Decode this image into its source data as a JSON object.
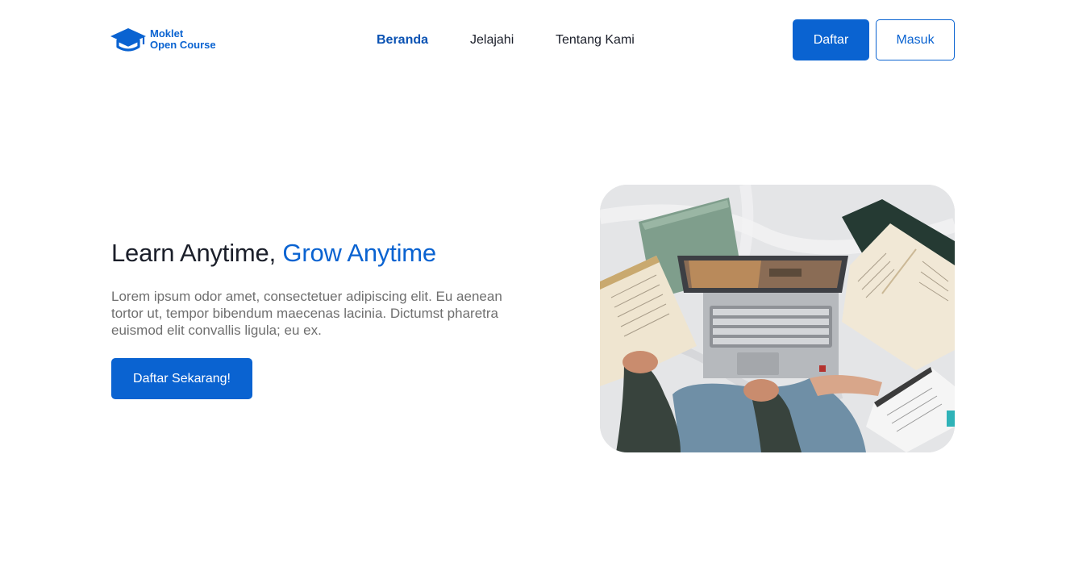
{
  "brand": {
    "line1": "Moklet",
    "line2": "Open Course",
    "icon": "graduation-cap-icon",
    "color": "#0a63d1"
  },
  "nav": {
    "items": [
      {
        "label": "Beranda",
        "active": true
      },
      {
        "label": "Jelajahi",
        "active": false
      },
      {
        "label": "Tentang Kami",
        "active": false
      }
    ]
  },
  "auth": {
    "register_label": "Daftar",
    "login_label": "Masuk"
  },
  "hero": {
    "title_main": "Learn Anytime,",
    "title_accent": "Grow Anytime",
    "description": "Lorem ipsum odor amet, consectetuer adipiscing elit. Eu aenean tortor ut, tempor bibendum maecenas lacinia. Dictumst pharetra euismod elit convallis ligula; eu ex.",
    "cta_label": "Daftar Sekarang!",
    "image_alt": "person studying with laptop and open books on a bed"
  },
  "colors": {
    "primary": "#0a63d1",
    "nav_active": "#0a52b3",
    "text": "#1b1f2a",
    "muted": "#6f6f6f"
  }
}
